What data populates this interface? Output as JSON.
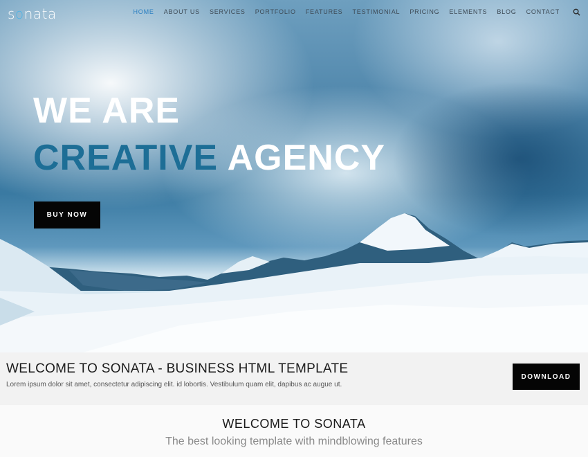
{
  "brand": {
    "logo_prefix": "s",
    "logo_o": "o",
    "logo_suffix": "nata"
  },
  "nav": {
    "items": [
      {
        "label": "HOME",
        "active": true
      },
      {
        "label": "ABOUT US"
      },
      {
        "label": "SERVICES"
      },
      {
        "label": "PORTFOLIO"
      },
      {
        "label": "FEATURES"
      },
      {
        "label": "TESTIMONIAL"
      },
      {
        "label": "PRICING"
      },
      {
        "label": "ELEMENTS"
      },
      {
        "label": "BLOG"
      },
      {
        "label": "CONTACT"
      }
    ],
    "search_icon": "search-icon"
  },
  "hero": {
    "line1": "WE ARE",
    "line2_accent": "CREATIVE",
    "line2_light": " AGENCY",
    "button": "BUY NOW"
  },
  "welcome_bar": {
    "title": "WELCOME TO SONATA - BUSINESS HTML TEMPLATE",
    "text": "Lorem ipsum dolor sit amet, consectetur adipiscing elit. id lobortis. Vestibulum quam elit, dapibus ac augue ut.",
    "button": "DOWNLOAD"
  },
  "intro": {
    "title": "WELCOME TO SONATA",
    "subtitle": "The best looking template with mindblowing features"
  },
  "colors": {
    "accent": "#1d6e96",
    "active_nav": "#2a7fc1",
    "logo_o": "#4fb3e6",
    "button_bg": "#050505"
  }
}
